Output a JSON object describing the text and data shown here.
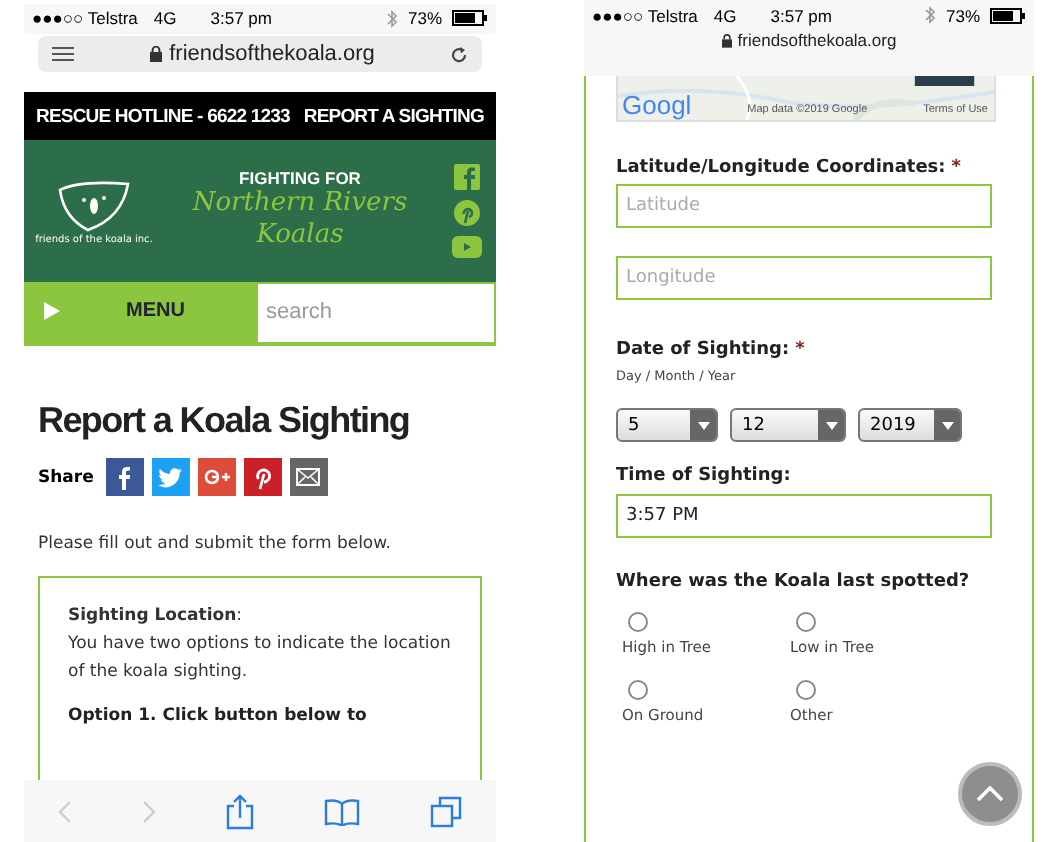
{
  "left_phone": {
    "status_bar": {
      "carrier": "●●●○○ Telstra",
      "network": "4G",
      "time": "3:57 pm",
      "battery": "73%"
    },
    "address_bar": {
      "url": "friendsofthekoala.org"
    },
    "top_bar": {
      "hotline": "RESCUE HOTLINE - 6622 1233",
      "report_link": "REPORT A SIGHTING"
    },
    "header": {
      "logo_text": "friends of the koala inc.",
      "tagline": "FIGHTING FOR",
      "title_line_1": "Northern Rivers",
      "title_line_2": "Koalas"
    },
    "nav": {
      "menu": "MENU",
      "search": {
        "placeholder": "search"
      }
    },
    "page": {
      "title": "Report a Koala Sighting",
      "share_label": "Share",
      "share_buttons": [
        {
          "kind": "facebook",
          "color": "#3b5998"
        },
        {
          "kind": "twitter",
          "color": "#1da1f2"
        },
        {
          "kind": "googleplus",
          "color": "#dd4b39"
        },
        {
          "kind": "pinterest",
          "color": "#cb2027"
        },
        {
          "kind": "email",
          "color": "#666666"
        }
      ],
      "intro": "Please fill out and submit the form below.",
      "form_heading": "Sighting Location",
      "form_heading_suffix": ":",
      "form_text": "You have two options to indicate the location of the koala sighting.",
      "option_text": "Option 1. Click button below to"
    }
  },
  "right_phone": {
    "status_bar": {
      "carrier": "●●●○○ Telstra",
      "network": "4G",
      "time": "3:57 pm",
      "battery": "73%"
    },
    "address_bar": {
      "url": "friendsofthekoala.org"
    },
    "map": {
      "logo": "Googl",
      "attribution": "Map data ©2019 Google",
      "terms": "Terms of Use"
    },
    "coords": {
      "label": "Latitude/Longitude Coordinates:",
      "required_mark": "*",
      "fields": [
        {
          "placeholder": "Latitude"
        },
        {
          "placeholder": "Longitude"
        }
      ]
    },
    "date": {
      "label": "Date of Sighting:",
      "required_mark": "*",
      "hint": "Day / Month / Year",
      "selects": [
        "5",
        "12",
        "2019"
      ]
    },
    "time": {
      "label": "Time of Sighting:",
      "value": "3:57 PM"
    },
    "spotted": {
      "label": "Where was the Koala last spotted?",
      "options": [
        {
          "label": "High in Tree",
          "selected": false
        },
        {
          "label": "Low in Tree",
          "selected": false
        },
        {
          "label": "On Ground",
          "selected": false
        },
        {
          "label": "Other",
          "selected": false
        }
      ]
    }
  }
}
